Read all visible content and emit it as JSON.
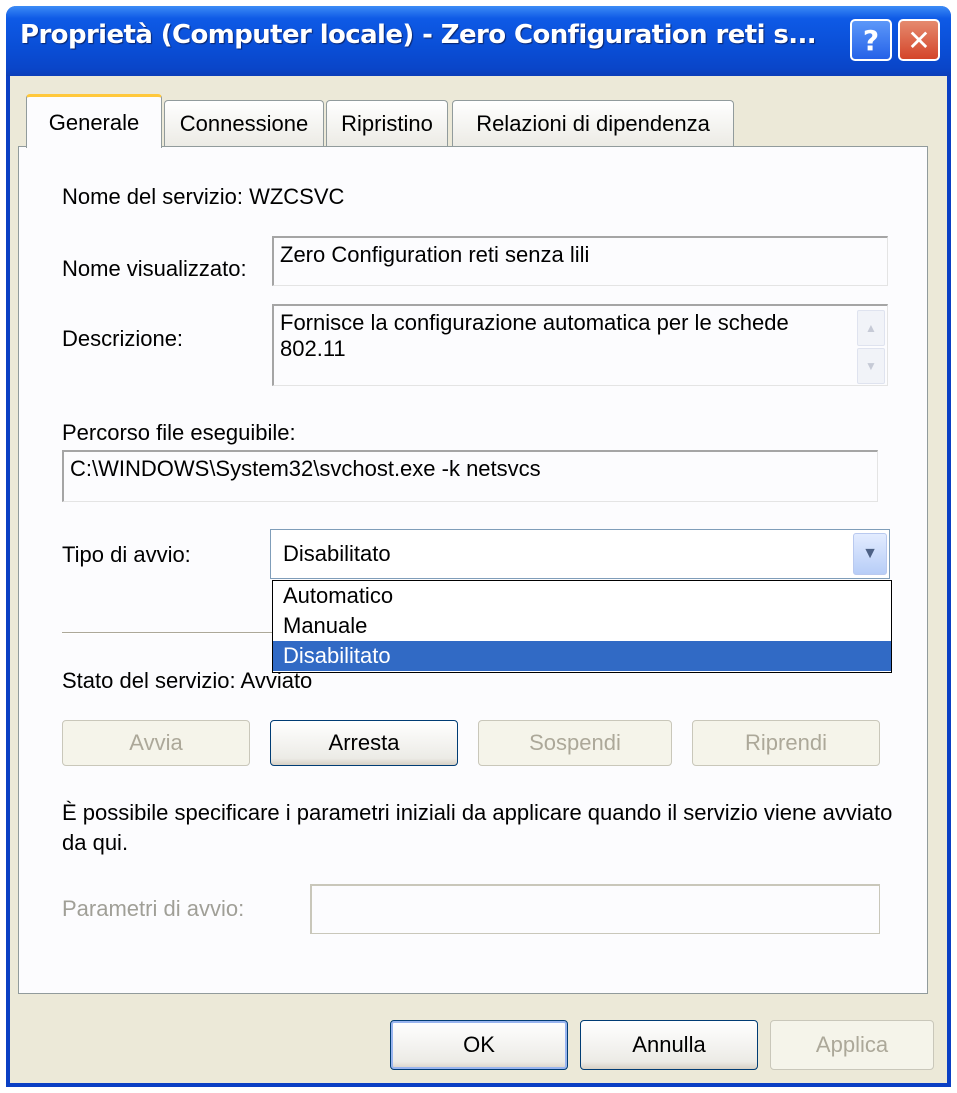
{
  "window": {
    "title": "Proprietà (Computer locale) - Zero Configuration reti s...",
    "help_glyph": "?",
    "close_glyph": "✕"
  },
  "tabs": [
    {
      "label": "Generale",
      "active": true
    },
    {
      "label": "Connessione",
      "active": false
    },
    {
      "label": "Ripristino",
      "active": false
    },
    {
      "label": "Relazioni di dipendenza",
      "active": false
    }
  ],
  "general": {
    "service_name_label": "Nome del servizio:",
    "service_name_value": "WZCSVC",
    "display_name_label": "Nome visualizzato:",
    "display_name_value": "Zero Configuration reti senza lili",
    "description_label": "Descrizione:",
    "description_value": "Fornisce la configurazione automatica per le schede 802.11",
    "exec_path_label": "Percorso file eseguibile:",
    "exec_path_value": "C:\\WINDOWS\\System32\\svchost.exe -k netsvcs",
    "startup_type_label": "Tipo di avvio:",
    "startup_type_selected": "Disabilitato",
    "startup_type_options": [
      "Automatico",
      "Manuale",
      "Disabilitato"
    ],
    "service_status_label": "Stato del servizio:",
    "service_status_value": "Avviato",
    "buttons": {
      "start": "Avvia",
      "stop": "Arresta",
      "pause": "Sospendi",
      "resume": "Riprendi"
    },
    "params_note": "È possibile specificare i parametri iniziali da applicare quando il servizio viene avviato da qui.",
    "params_label": "Parametri di avvio:",
    "params_value": ""
  },
  "footer": {
    "ok": "OK",
    "cancel": "Annulla",
    "apply": "Applica"
  },
  "colors": {
    "titlebar": "#0a4ed6",
    "selection": "#316ac5",
    "tab_highlight": "#ffc83c",
    "dialog_bg": "#ece9d8"
  },
  "icons": {
    "combo_arrow": "chevron-down-icon",
    "scroll_up": "scroll-up-icon",
    "scroll_down": "scroll-down-icon"
  }
}
